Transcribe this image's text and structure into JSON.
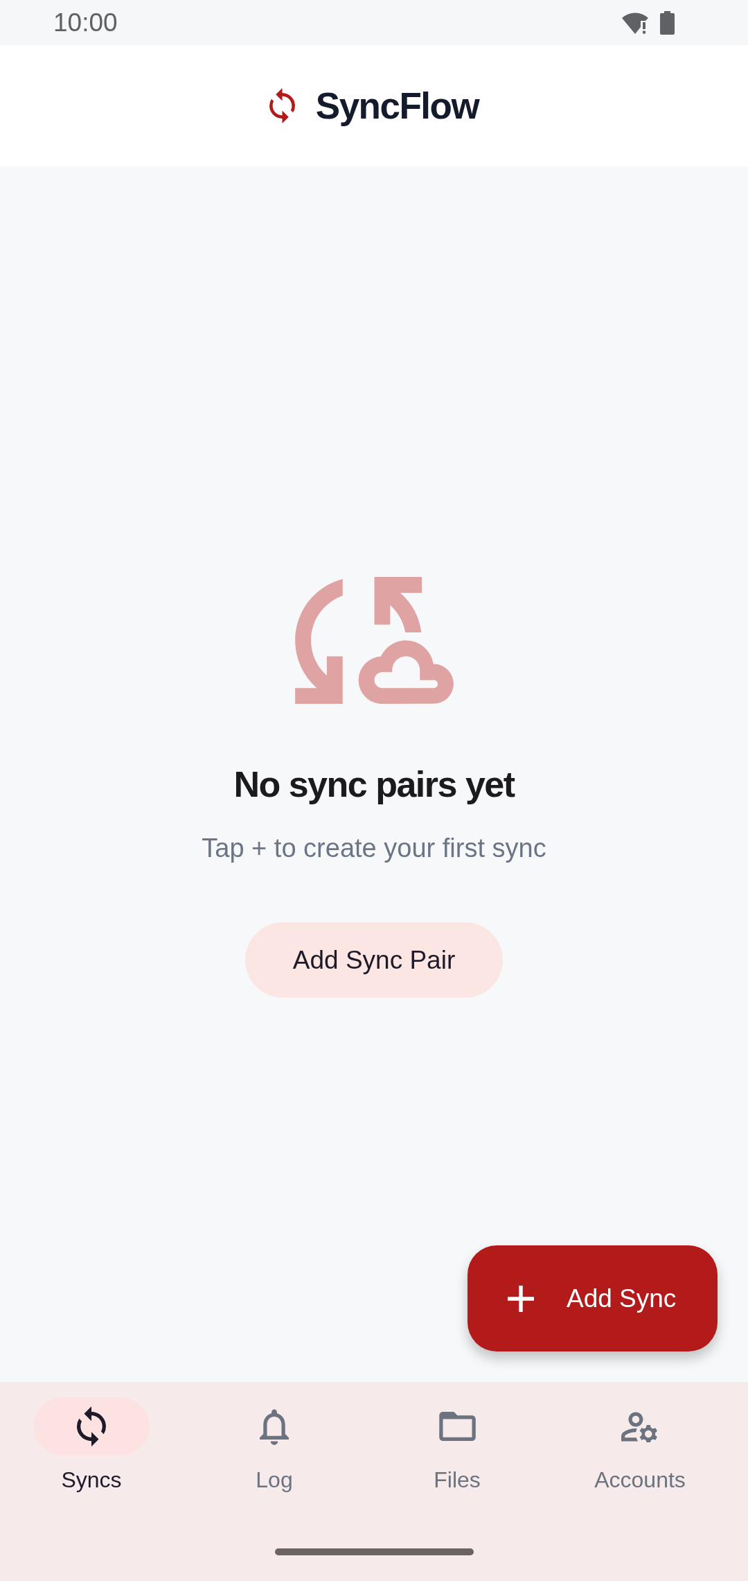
{
  "status_bar": {
    "time": "10:00"
  },
  "app_bar": {
    "title": "SyncFlow"
  },
  "empty_state": {
    "title": "No sync pairs yet",
    "subtitle": "Tap + to create your first sync",
    "button": "Add Sync Pair"
  },
  "fab": {
    "label": "Add Sync"
  },
  "bottom_nav": {
    "items": [
      {
        "label": "Syncs",
        "kind": "sync",
        "selected": true
      },
      {
        "label": "Log",
        "kind": "bell",
        "selected": false
      },
      {
        "label": "Files",
        "kind": "folder",
        "selected": false
      },
      {
        "label": "Accounts",
        "kind": "accounts",
        "selected": false
      }
    ]
  }
}
